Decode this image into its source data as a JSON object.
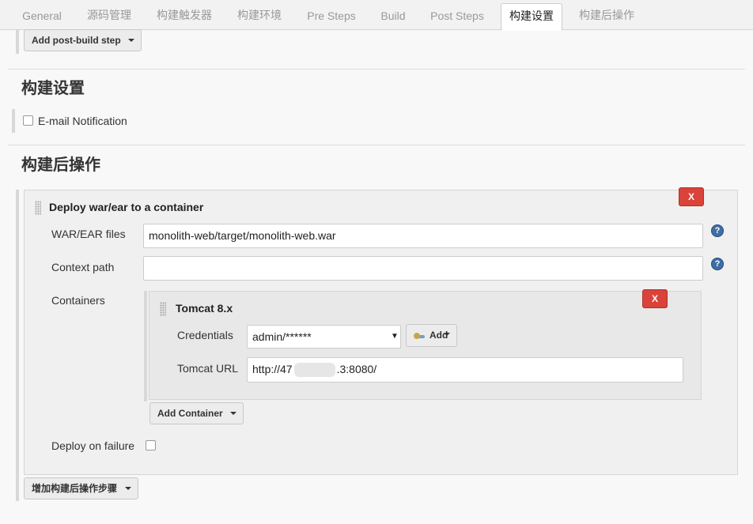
{
  "tabs": [
    {
      "label": "General"
    },
    {
      "label": "源码管理"
    },
    {
      "label": "构建触发器"
    },
    {
      "label": "构建环境"
    },
    {
      "label": "Pre Steps"
    },
    {
      "label": "Build"
    },
    {
      "label": "Post Steps"
    },
    {
      "label": "构建设置",
      "active": true
    },
    {
      "label": "构建后操作"
    }
  ],
  "post_steps": {
    "add_button": "Add post-build step"
  },
  "build_settings": {
    "title": "构建设置",
    "email_notification": {
      "label": "E-mail Notification",
      "checked": false
    }
  },
  "post_build": {
    "title": "构建后操作",
    "deploy": {
      "title": "Deploy war/ear to a container",
      "delete_label": "X",
      "war_files": {
        "label": "WAR/EAR files",
        "value": "monolith-web/target/monolith-web.war"
      },
      "context_path": {
        "label": "Context path",
        "value": ""
      },
      "containers": {
        "label": "Containers",
        "tomcat": {
          "title": "Tomcat 8.x",
          "delete_label": "X",
          "credentials": {
            "label": "Credentials",
            "value": "admin/******"
          },
          "add_button": "Add",
          "url": {
            "label": "Tomcat URL",
            "prefix": "http://47",
            "suffix": ".3:8080/"
          }
        },
        "add_container": "Add Container"
      },
      "deploy_on_failure": {
        "label": "Deploy on failure",
        "checked": false
      }
    },
    "add_step_button": "增加构建后操作步骤"
  },
  "help_icon": {
    "glyph": "?",
    "color": "#3f6da5"
  },
  "delete_color": "#d9433a"
}
